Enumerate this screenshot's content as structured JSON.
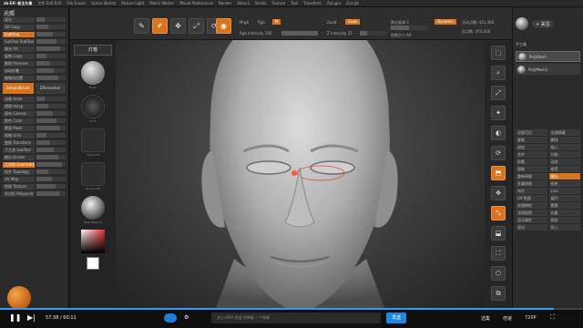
{
  "menubar": {
    "app": "zb-EX-  新主头像",
    "items": [
      "文件 Edit  Edit",
      "File  Eraser",
      "Scene Sketch",
      "Picture  Light",
      "Macro  Marker",
      "Movie  Preferences",
      "Render",
      "Stencil",
      "Stroke",
      "Texture",
      "Tool",
      "Transform",
      "Zplugin",
      "Zscript"
    ]
  },
  "left_panel": {
    "title": "光照",
    "rows": [
      {
        "label": "面光",
        "o": false
      },
      {
        "label": "3D Copy",
        "o": false
      },
      {
        "label": "Lighting",
        "o": true
      },
      {
        "label": "SubTool  SubTool",
        "o": false
      },
      {
        "label": "填充  Fill",
        "o": false
      },
      {
        "label": "复制 Copy",
        "o": false
      },
      {
        "label": "删除 Remove",
        "o": false
      },
      {
        "label": "自动折叠",
        "o": false
      },
      {
        "label": "摄像机设置",
        "o": false
      }
    ],
    "tabs": [
      "SimpleBrush",
      "ZRemesher"
    ],
    "rows2": [
      {
        "label": "动画 Anim",
        "o": false
      },
      {
        "label": "透视 Persp",
        "o": false
      },
      {
        "label": "画布 Canvas",
        "o": false
      },
      {
        "label": "颜色 Color",
        "o": false
      },
      {
        "label": "蒙版 Mask",
        "o": false
      },
      {
        "label": "网格 Grid",
        "o": false
      },
      {
        "label": "变换 Transform",
        "o": false
      },
      {
        "label": "子工具 SubTool",
        "o": false
      },
      {
        "label": "细分 Divide",
        "o": false
      },
      {
        "label": "几何体 Geometry",
        "o": true
      },
      {
        "label": "拓扑 Topology",
        "o": false
      },
      {
        "label": "UV Map",
        "o": false
      },
      {
        "label": "纹理 Texture",
        "o": false
      },
      {
        "label": "多边形 Polypaint",
        "o": false
      }
    ]
  },
  "tools": {
    "button": "灯箱",
    "labels": [
      "Brush",
      "Dots",
      "Alpha Off",
      "Texture Off",
      "BasicMaterial"
    ]
  },
  "shelf": {
    "mrgb": "Mrgb",
    "rgb": "Rgb",
    "m": "M",
    "zadd": "Zadd",
    "zsub": "Zsub",
    "rgb_intensity": "Rgb Intensity 100",
    "focal": "焦点衰减 0",
    "draw_size": "绘制大小 64",
    "z_intensity": "Z Intensity 25",
    "dynamic": "Dynamic",
    "active_points": "活动点数: 421,460",
    "total_points": "总点数: 474,420"
  },
  "right_strip": [
    "⬚",
    "⌕",
    "⤢",
    "✦",
    "◐",
    "⟳",
    "⬒",
    "✥",
    "⤡",
    "⬓",
    "⛶",
    "⬡",
    "⧉"
  ],
  "right_panel": {
    "follow": "+ 关注",
    "subtool_title": "子工具",
    "subtools": [
      "PolyMesh",
      "PolyMesh1"
    ],
    "rows": [
      {
        "a": "全部可见",
        "b": "全部隐藏",
        "o": false
      },
      {
        "a": "复制",
        "b": "删除",
        "o": false
      },
      {
        "a": "追加",
        "b": "插入",
        "o": false
      },
      {
        "a": "合并",
        "b": "分割",
        "o": false
      },
      {
        "a": "投影",
        "b": "动态",
        "o": false
      },
      {
        "a": "提取",
        "b": "接受",
        "o": false
      },
      {
        "a": "重新网格",
        "b": "细分",
        "o": true
      },
      {
        "a": "多重网格",
        "b": "投射",
        "o": false
      },
      {
        "a": "布尔",
        "b": "Live",
        "o": false
      },
      {
        "a": "UV 贴图",
        "b": "展开",
        "o": false
      },
      {
        "a": "纹理映射",
        "b": "置换",
        "o": false
      },
      {
        "a": "法线贴图",
        "b": "向量",
        "o": false
      },
      {
        "a": "显示属性",
        "b": "预览",
        "o": false
      },
      {
        "a": "导出",
        "b": "导入",
        "o": false
      }
    ]
  },
  "player": {
    "progress": 0.95,
    "time": "57:38 / 60:11",
    "danmu_placeholder": "关于 HDR 频道 的弹幕 一个弹幕",
    "send": "发送",
    "options": [
      "选集",
      "倍速",
      "720P",
      "⛶"
    ]
  }
}
